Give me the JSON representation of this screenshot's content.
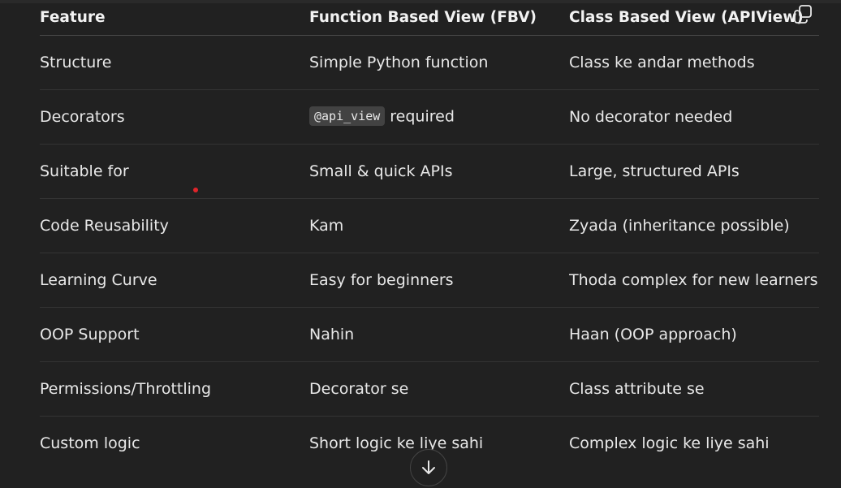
{
  "table": {
    "headers": [
      "Feature",
      "Function Based View (FBV)",
      "Class Based View (APIView)"
    ],
    "rows": [
      {
        "feature": "Structure",
        "fbv": "Simple Python function",
        "cbv": "Class ke andar methods"
      },
      {
        "feature": "Decorators",
        "fbv_code": "@api_view",
        "fbv": "required",
        "cbv": "No decorator needed"
      },
      {
        "feature": "Suitable for",
        "fbv": "Small & quick APIs",
        "cbv": "Large, structured APIs"
      },
      {
        "feature": "Code Reusability",
        "fbv": "Kam",
        "cbv": "Zyada (inheritance possible)"
      },
      {
        "feature": "Learning Curve",
        "fbv": "Easy for beginners",
        "cbv": "Thoda complex for new learners"
      },
      {
        "feature": "OOP Support",
        "fbv": "Nahin",
        "cbv": "Haan (OOP approach)"
      },
      {
        "feature": "Permissions/Throttling",
        "fbv": "Decorator se",
        "cbv": "Class attribute se"
      },
      {
        "feature": "Custom logic",
        "fbv": "Short logic ke liye sahi",
        "cbv": "Complex logic ke liye sahi"
      }
    ]
  },
  "icons": {
    "copy": "copy-icon",
    "scroll_down": "arrow-down-icon"
  },
  "colors": {
    "background": "#212121",
    "text": "#ececec",
    "code_chip_bg": "#424242",
    "marker_dot": "#e0242a"
  }
}
